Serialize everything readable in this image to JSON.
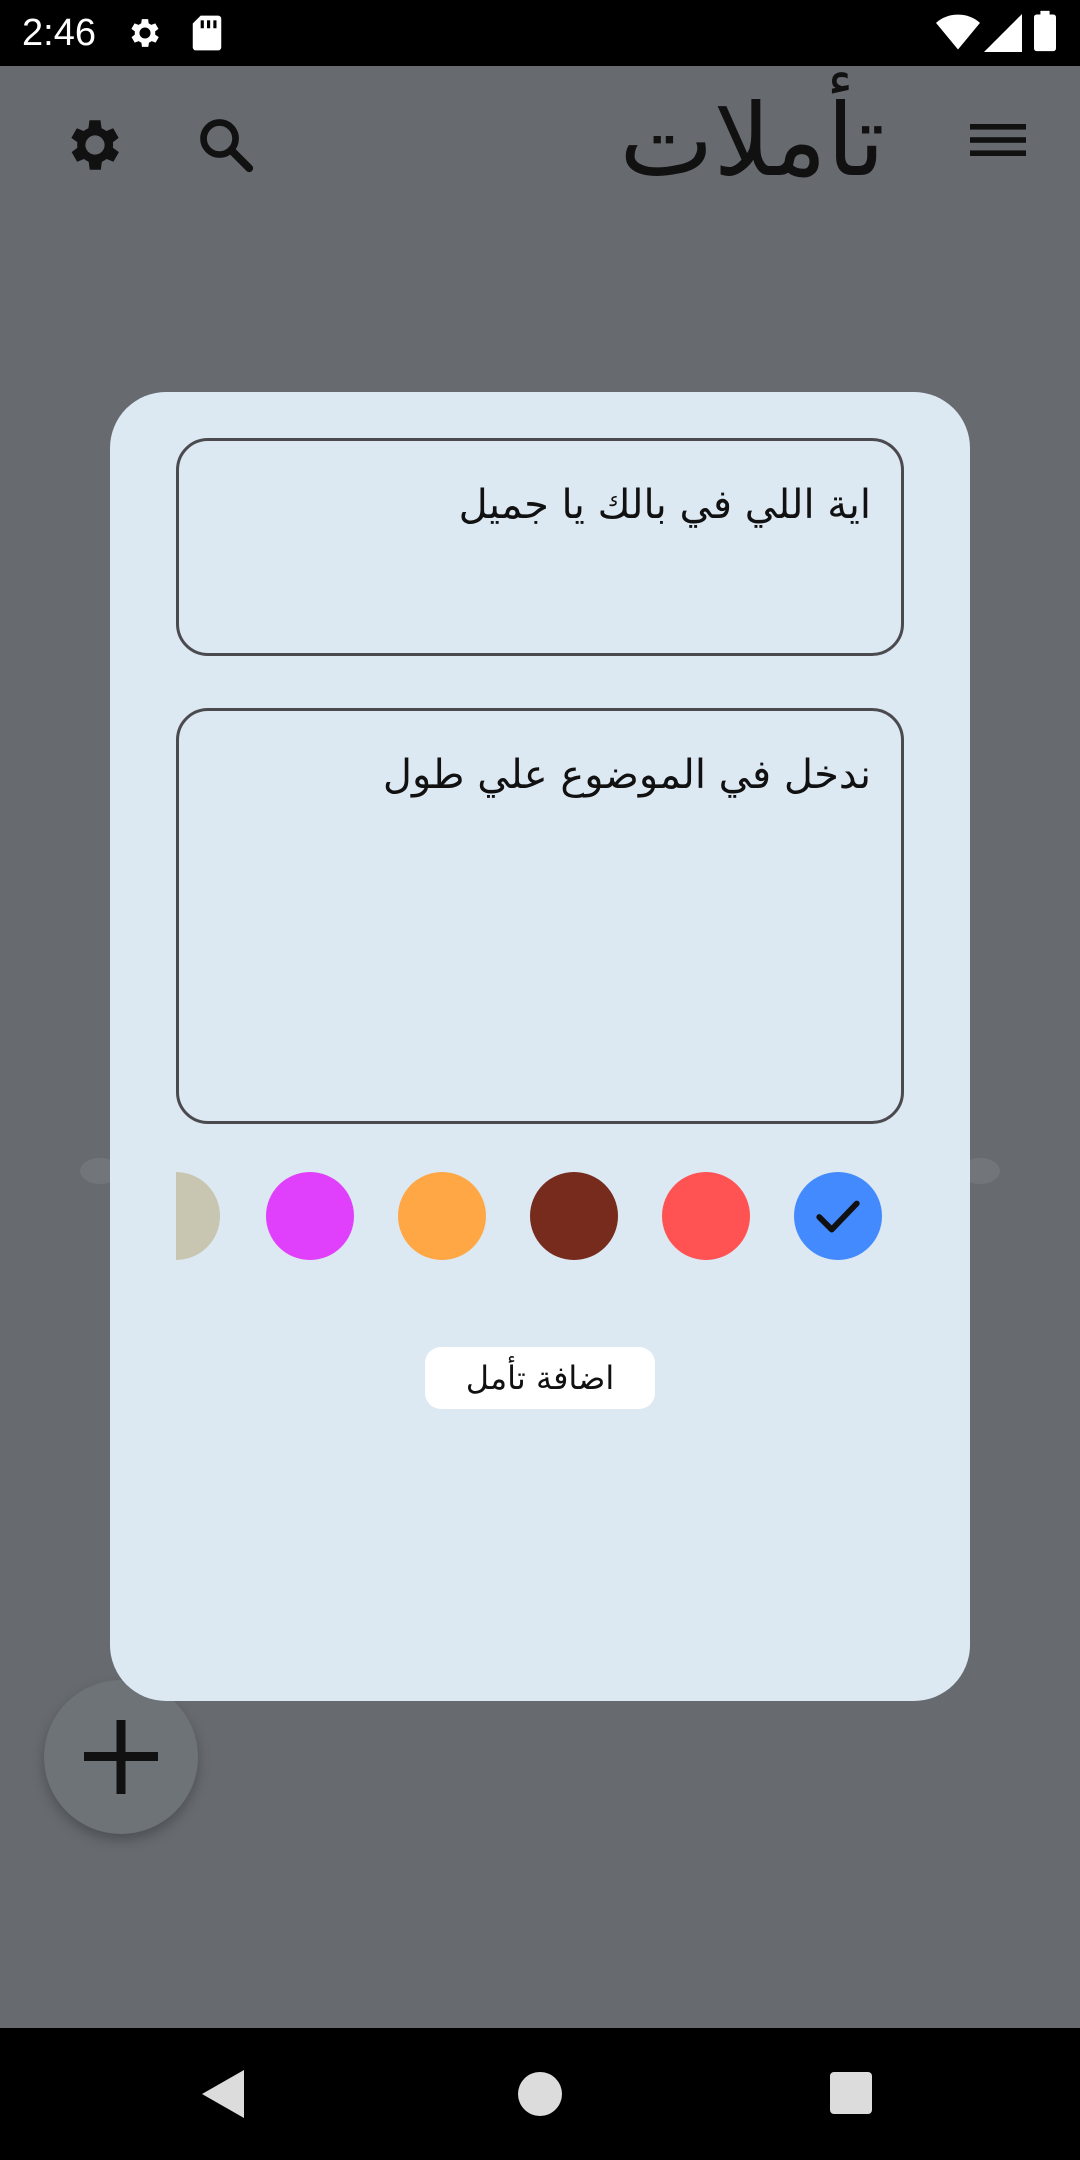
{
  "status_bar": {
    "time": "2:46",
    "icons": [
      "gear-icon",
      "sd-card-icon",
      "wifi-icon",
      "signal-icon",
      "battery-icon"
    ]
  },
  "app_bar": {
    "title": "تأملات",
    "menu_icon": "hamburger-menu-icon",
    "search_icon": "search-icon",
    "settings_icon": "gear-icon"
  },
  "dialog": {
    "title_field": {
      "value": "اية اللي في بالك يا جميل"
    },
    "body_field": {
      "value": "ندخل في الموضوع علي طول"
    },
    "colors": [
      {
        "name": "beige",
        "hex": "#c8c6b0"
      },
      {
        "name": "magenta",
        "hex": "#e040fb"
      },
      {
        "name": "orange",
        "hex": "#ffa645"
      },
      {
        "name": "brown",
        "hex": "#772b1d"
      },
      {
        "name": "red",
        "hex": "#ff5252"
      },
      {
        "name": "blue",
        "hex": "#448aff",
        "selected": true
      }
    ],
    "add_button_label": "اضافة تأمل"
  },
  "fab_icon": "plus-icon",
  "nav_bar": {
    "icons": [
      "back-icon",
      "home-icon",
      "recents-icon"
    ]
  },
  "theme": {
    "scrim": "#676b70",
    "dialog_bg": "#dce8f2"
  }
}
